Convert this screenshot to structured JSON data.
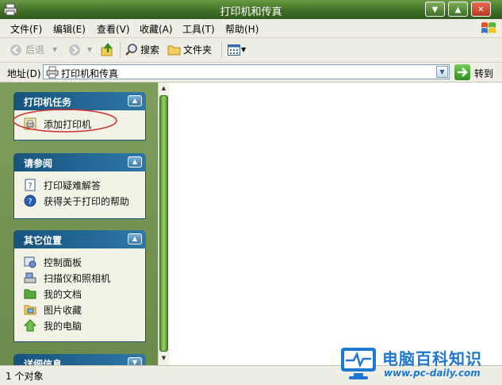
{
  "window": {
    "title": "打印机和传真"
  },
  "menubar": {
    "items": [
      "文件(F)",
      "编辑(E)",
      "查看(V)",
      "收藏(A)",
      "工具(T)",
      "帮助(H)"
    ]
  },
  "toolbar": {
    "back": "后退",
    "search": "搜索",
    "folders": "文件夹"
  },
  "address": {
    "label": "地址(D)",
    "value": "打印机和传真",
    "go": "转到"
  },
  "panels": [
    {
      "title": "打印机任务",
      "items": [
        {
          "label": "添加打印机",
          "icon": "add-printer-icon"
        }
      ]
    },
    {
      "title": "请参阅",
      "items": [
        {
          "label": "打印疑难解答",
          "icon": "help-book-icon"
        },
        {
          "label": "获得关于打印的帮助",
          "icon": "help-circle-icon"
        }
      ]
    },
    {
      "title": "其它位置",
      "items": [
        {
          "label": "控制面板",
          "icon": "control-panel-icon"
        },
        {
          "label": "扫描仪和照相机",
          "icon": "scanner-camera-icon"
        },
        {
          "label": "我的文档",
          "icon": "folder-icon"
        },
        {
          "label": "图片收藏",
          "icon": "pictures-folder-icon"
        },
        {
          "label": "我的电脑",
          "icon": "computer-icon"
        }
      ]
    },
    {
      "title": "详细信息",
      "items": []
    }
  ],
  "status": {
    "text": "1 个对象"
  },
  "watermark": {
    "title": "电脑百科知识",
    "url": "www.pc-daily.com"
  },
  "colors": {
    "titlebar": "#3f7127",
    "panel_header": "#17547d",
    "pane_bg": "#7f9e5f",
    "highlight_oval": "#d0312d",
    "watermark": "#1e77d2"
  }
}
